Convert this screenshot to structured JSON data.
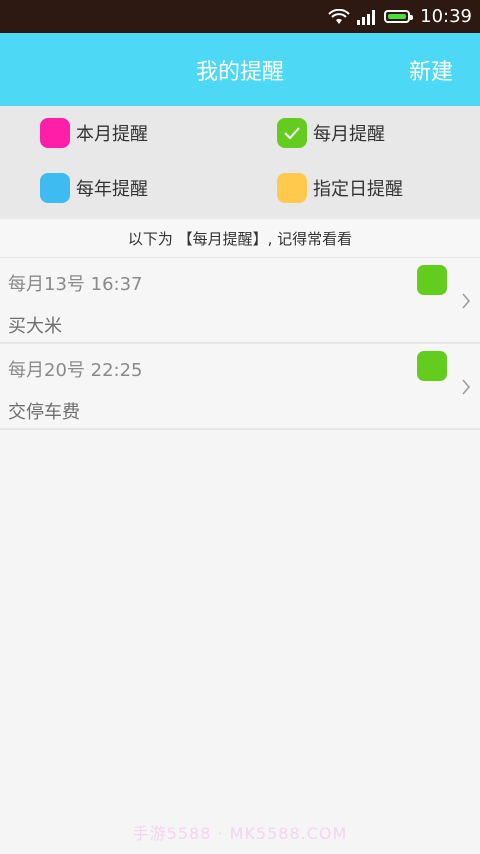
{
  "status_bar": {
    "time": "10:39"
  },
  "header": {
    "title": "我的提醒",
    "new_label": "新建"
  },
  "legend": [
    {
      "label": "本月提醒",
      "color": "#ff1ea7",
      "checked": false
    },
    {
      "label": "每月提醒",
      "color": "#64cc1f",
      "checked": true
    },
    {
      "label": "每年提醒",
      "color": "#3ebcf2",
      "checked": false
    },
    {
      "label": "指定日提醒",
      "color": "#ffc94e",
      "checked": false
    }
  ],
  "notice": "以下为 【每月提醒】, 记得常看看",
  "reminders": [
    {
      "time": "每月13号 16:37",
      "title": "买大米",
      "color": "#64cc1f"
    },
    {
      "time": "每月20号 22:25",
      "title": "交停车费",
      "color": "#64cc1f"
    }
  ],
  "watermark": "手游5588 · MK5588.COM"
}
